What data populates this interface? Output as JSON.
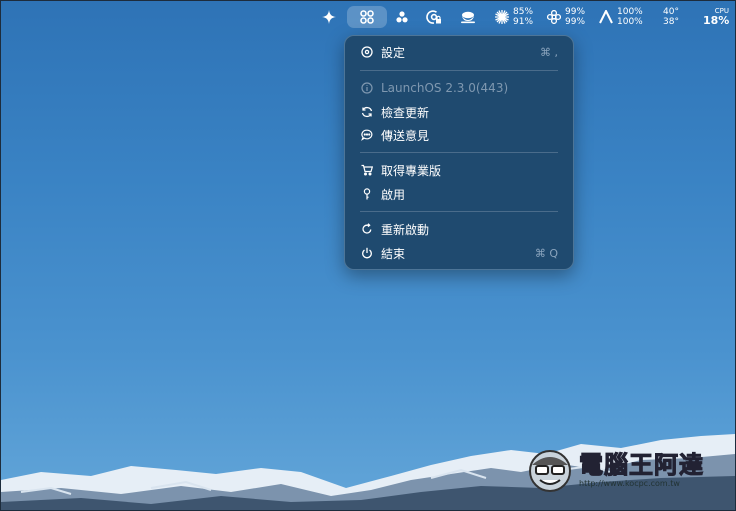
{
  "menubar": {
    "stats": [
      {
        "top": "85%",
        "bottom": "91%"
      },
      {
        "top": "99%",
        "bottom": "99%"
      },
      {
        "top": "100%",
        "bottom": "100%"
      }
    ],
    "temp": {
      "top": "40°",
      "bottom": "38°"
    },
    "cpu": {
      "label": "CPU",
      "value": "18%"
    }
  },
  "menu": {
    "settings": {
      "label": "設定",
      "shortcut": "⌘ ,"
    },
    "version": "LaunchOS 2.3.0(443)",
    "check_updates": "檢查更新",
    "send_feedback": "傳送意見",
    "get_pro": "取得專業版",
    "activate": "啟用",
    "restart": "重新啟動",
    "quit": {
      "label": "結束",
      "shortcut": "⌘ Q"
    }
  },
  "watermark": {
    "brand": "電腦王阿達",
    "url": "http://www.kocpc.com.tw"
  },
  "colors": {
    "desktop": "#3a83c4",
    "menu_bg": "#1f4a6f",
    "menu_border": "#4d7597"
  }
}
